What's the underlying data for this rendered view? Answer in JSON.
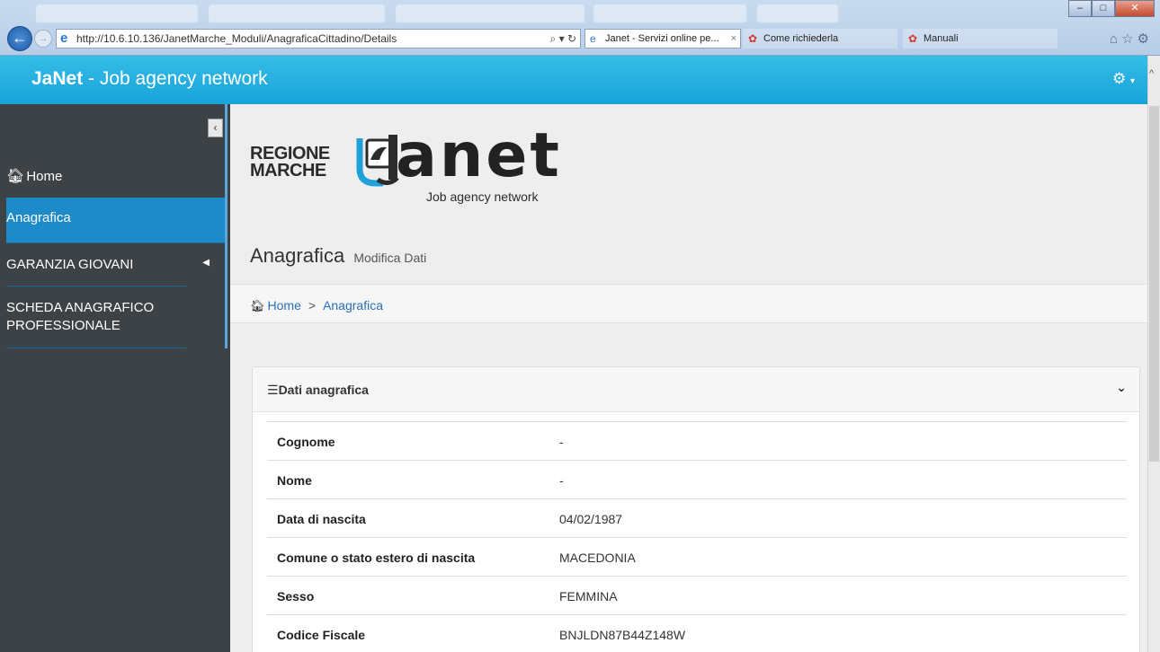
{
  "browser": {
    "url": "http://10.6.10.136/JanetMarche_Moduli/AnagraficaCittadino/Details",
    "tabs": [
      {
        "label": "Janet - Servizi online pe...",
        "active": true
      },
      {
        "label": "Come richiederla",
        "active": false
      },
      {
        "label": "Manuali",
        "active": false
      }
    ]
  },
  "header": {
    "brand_bold": "JaNet",
    "brand_rest": " - Job agency network",
    "settings_icon": "gear-icon"
  },
  "sidebar": {
    "toggle_label": "‹",
    "items": [
      {
        "label": "Home",
        "icon": "home-icon"
      },
      {
        "label": "Anagrafica",
        "active": true
      },
      {
        "label": "GARANZIA GIOVANI",
        "has_submenu": true
      },
      {
        "label": "SCHEDA ANAGRAFICO PROFESSIONALE"
      }
    ]
  },
  "logo": {
    "regione_line1": "REGIONE",
    "regione_line2": "MARCHE",
    "janet": "anet",
    "subtitle": "Job agency network"
  },
  "page": {
    "title": "Anagrafica",
    "subtitle": "Modifica Dati"
  },
  "breadcrumb": [
    "Home",
    "Anagrafica"
  ],
  "panel": {
    "title": "Dati anagrafica",
    "rows": [
      {
        "label": "Cognome",
        "value": "-"
      },
      {
        "label": "Nome",
        "value": "-"
      },
      {
        "label": "Data di nascita",
        "value": "04/02/1987"
      },
      {
        "label": "Comune o stato estero di nascita",
        "value": "MACEDONIA"
      },
      {
        "label": "Sesso",
        "value": "FEMMINA"
      },
      {
        "label": "Codice Fiscale",
        "value": "BNJLDN87B44Z148W"
      }
    ]
  },
  "colors": {
    "header": "#1fa9dd",
    "sidebar": "#3d4247",
    "sidebar_active": "#1d8ac9",
    "link": "#2a6fb0"
  }
}
